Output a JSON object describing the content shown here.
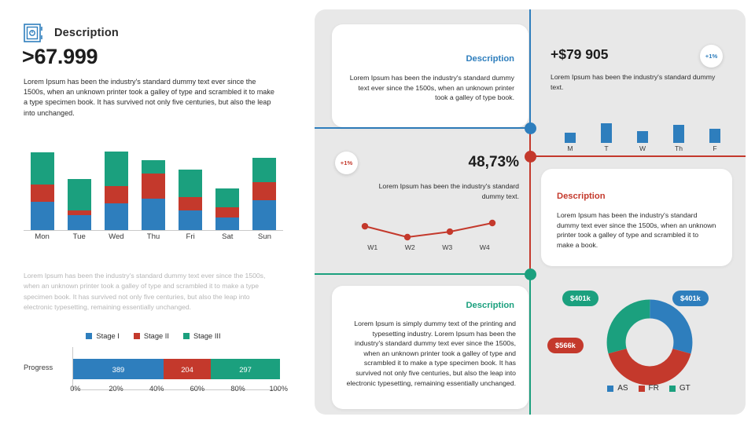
{
  "colors": {
    "blue": "#2e7ebd",
    "red": "#c4392c",
    "green": "#1ba07e",
    "panel_bg": "#e8e8e8",
    "muted_text": "#b6b6b6"
  },
  "left": {
    "icon": "vault-icon",
    "title": "Description",
    "big_number": ">67.999",
    "lead_paragraph": "Lorem Ipsum has been the industry's standard dummy text ever since the 1500s, when an unknown printer took a galley of type and scrambled it to make a type specimen book. It has survived not only five centuries, but also the leap into unchanged.",
    "mid_paragraph": "Lorem Ipsum has been the industry's standard dummy text ever since the 1500s, when an unknown printer took a galley of type and scrambled it to make a type specimen book. It has survived not only five centuries, but also the leap into electronic typesetting, remaining essentially unchanged.",
    "legend": [
      {
        "label": "Stage I",
        "color": "#2e7ebd"
      },
      {
        "label": "Stage II",
        "color": "#c4392c"
      },
      {
        "label": "Stage III",
        "color": "#1ba07e"
      }
    ],
    "progress": {
      "row_label": "Progress",
      "segments": [
        {
          "label": "Stage I",
          "value": "389",
          "color": "#2e7ebd",
          "pct": 43.7
        },
        {
          "label": "Stage II",
          "value": "204",
          "color": "#c4392c",
          "pct": 22.9
        },
        {
          "label": "Stage III",
          "value": "297",
          "color": "#1ba07e",
          "pct": 33.4
        }
      ],
      "axis_ticks": [
        "0%",
        "20%",
        "40%",
        "60%",
        "80%",
        "100%"
      ]
    }
  },
  "right": {
    "card_top_left": {
      "title": "Description",
      "title_color": "#2e7ebd",
      "body": "Lorem Ipsum has been the industry's standard dummy text ever since the 1500s, when an unknown printer took a galley of type book."
    },
    "kpi_top_right": {
      "value": "+$79 905",
      "sub": "Lorem Ipsum has been the industry's standard dummy text.",
      "badge": "+1%",
      "badge_color": "#2e7ebd"
    },
    "kpi_middle_left": {
      "value": "48,73%",
      "sub": "Lorem Ipsum has been the industry's standard dummy text.",
      "badge": "+1%",
      "badge_color": "#c4392c"
    },
    "card_middle_right": {
      "title": "Description",
      "title_color": "#c4392c",
      "body": "Lorem Ipsum has been the industry's standard dummy text ever since the 1500s, when an unknown printer took a galley of type and scrambled it to make a book."
    },
    "card_bottom_left": {
      "title": "Description",
      "title_color": "#1ba07e",
      "body": "Lorem Ipsum is simply dummy text of the printing and typesetting industry. Lorem Ipsum has been the industry's standard dummy text ever since the 1500s, when an unknown printer took a galley of type and scrambled it to make a type specimen book. It has survived not only five centuries, but also the leap into electronic typesetting, remaining essentially unchanged."
    },
    "donut_labels": [
      {
        "text": "$401k",
        "color": "#1ba07e"
      },
      {
        "text": "$401k",
        "color": "#2e7ebd"
      },
      {
        "text": "$566k",
        "color": "#c4392c"
      }
    ],
    "donut_legend": [
      {
        "label": "AS",
        "color": "#2e7ebd"
      },
      {
        "label": "FR",
        "color": "#c4392c"
      },
      {
        "label": "GT",
        "color": "#1ba07e"
      }
    ]
  },
  "chart_data": [
    {
      "type": "bar",
      "name": "weekly-stacked-bars",
      "stacked": true,
      "categories": [
        "Mon",
        "Tue",
        "Wed",
        "Thu",
        "Fri",
        "Sat",
        "Sun"
      ],
      "series": [
        {
          "name": "Stage I",
          "color": "#2e7ebd",
          "values": [
            38,
            20,
            36,
            42,
            27,
            17,
            40
          ]
        },
        {
          "name": "Stage II",
          "color": "#c4392c",
          "values": [
            22,
            6,
            22,
            32,
            17,
            14,
            23
          ]
        },
        {
          "name": "Stage III",
          "color": "#1ba07e",
          "values": [
            42,
            41,
            45,
            18,
            35,
            24,
            32
          ]
        }
      ],
      "title": "",
      "xlabel": "",
      "ylabel": "",
      "ylim": [
        0,
        110
      ],
      "grid": false,
      "legend_position": "bottom"
    },
    {
      "type": "bar",
      "name": "progress-stacked-single",
      "stacked": true,
      "categories": [
        "Progress"
      ],
      "series": [
        {
          "name": "Stage I",
          "color": "#2e7ebd",
          "values": [
            389
          ]
        },
        {
          "name": "Stage II",
          "color": "#c4392c",
          "values": [
            204
          ]
        },
        {
          "name": "Stage III",
          "color": "#1ba07e",
          "values": [
            297
          ]
        }
      ],
      "data_labels": [
        "389",
        "204",
        "297"
      ],
      "xlabel": "",
      "ylabel": "",
      "x_ticks": [
        "0%",
        "20%",
        "40%",
        "60%",
        "80%",
        "100%"
      ],
      "orientation": "horizontal",
      "grid": false,
      "legend_position": "top"
    },
    {
      "type": "bar",
      "name": "weekday-mini-bars",
      "categories": [
        "M",
        "T",
        "W",
        "Th",
        "F"
      ],
      "values": [
        11,
        22,
        13,
        20,
        16
      ],
      "color": "#2e7ebd",
      "title": "",
      "xlabel": "",
      "ylabel": "",
      "ylim": [
        0,
        26
      ],
      "grid": false,
      "legend_position": "none"
    },
    {
      "type": "line",
      "name": "weekly-trend-line",
      "categories": [
        "W1",
        "W2",
        "W3",
        "W4"
      ],
      "values": [
        62,
        42,
        52,
        68
      ],
      "color": "#c4392c",
      "title": "",
      "xlabel": "",
      "ylabel": "",
      "ylim": [
        0,
        100
      ],
      "grid": false,
      "markers": true,
      "legend_position": "none"
    },
    {
      "type": "pie",
      "name": "regional-donut",
      "donut": true,
      "labels": [
        "AS",
        "FR",
        "GT"
      ],
      "values": [
        401,
        566,
        401
      ],
      "display_values": [
        "$401k",
        "$566k",
        "$401k"
      ],
      "colors": [
        "#2e7ebd",
        "#c4392c",
        "#1ba07e"
      ],
      "title": "",
      "legend_position": "bottom"
    }
  ]
}
